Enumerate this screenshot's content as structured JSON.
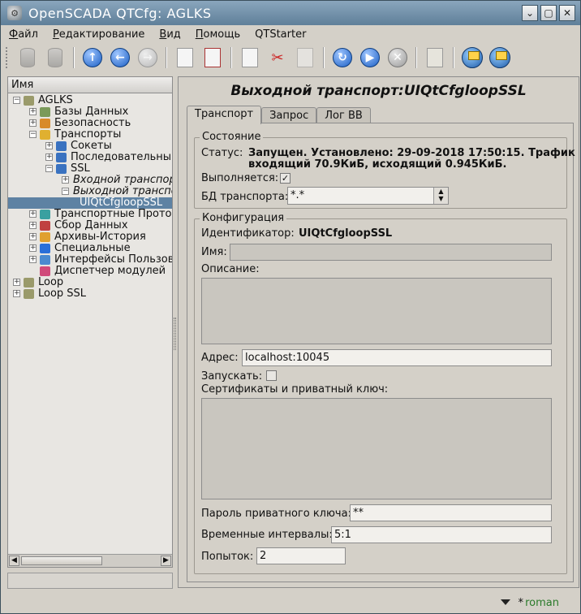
{
  "window": {
    "title": "OpenSCADA QTCfg: AGLKS",
    "buttons": [
      "⌄",
      "▢",
      "✕"
    ]
  },
  "menu": {
    "items": [
      {
        "underline": "Ф",
        "rest": "айл"
      },
      {
        "underline": "Р",
        "rest": "едактирование"
      },
      {
        "underline": "В",
        "rest": "ид"
      },
      {
        "underline": "П",
        "rest": "омощь"
      },
      {
        "underline": "",
        "rest": "QTStarter"
      }
    ]
  },
  "toolbar": {
    "icons": [
      "db-load-icon",
      "db-save-icon",
      "up-icon",
      "back-icon",
      "forward-icon",
      "add-item-icon",
      "delete-item-icon",
      "copy-icon",
      "cut-icon",
      "paste-icon",
      "refresh-icon",
      "start-icon",
      "stop-icon",
      "manual-icon",
      "remote-station-icon",
      "remote-station2-icon"
    ]
  },
  "tree": {
    "header": "Имя",
    "items": [
      {
        "label": "AGLKS",
        "indent": 0,
        "exp": "−",
        "icon": "station-icon",
        "color": "#9a9a6a"
      },
      {
        "label": "Базы Данных",
        "indent": 1,
        "exp": "+",
        "icon": "database-icon",
        "color": "#7a9a5a"
      },
      {
        "label": "Безопасность",
        "indent": 1,
        "exp": "+",
        "icon": "security-icon",
        "color": "#d88a2a"
      },
      {
        "label": "Транспорты",
        "indent": 1,
        "exp": "−",
        "icon": "transport-icon",
        "color": "#e0b030"
      },
      {
        "label": "Сокеты",
        "indent": 2,
        "exp": "+",
        "icon": "sockets-icon",
        "color": "#3a72c0"
      },
      {
        "label": "Последовательны",
        "indent": 2,
        "exp": "+",
        "icon": "serial-icon",
        "color": "#3a72c0"
      },
      {
        "label": "SSL",
        "indent": 2,
        "exp": "−",
        "icon": "ssl-icon",
        "color": "#3a72c0"
      },
      {
        "label": "Входной транспор",
        "indent": 3,
        "exp": "+",
        "icon": "",
        "color": "",
        "italic": true
      },
      {
        "label": "Выходной транспо",
        "indent": 3,
        "exp": "−",
        "icon": "",
        "color": "",
        "italic": true
      },
      {
        "label": "UIQtCfgloopSSL",
        "indent": 4,
        "exp": "",
        "icon": "",
        "color": "",
        "selected": true
      },
      {
        "label": "Транспортные Прото",
        "indent": 1,
        "exp": "+",
        "icon": "protocols-icon",
        "color": "#3aa0a0"
      },
      {
        "label": "Сбор Данных",
        "indent": 1,
        "exp": "+",
        "icon": "daq-icon",
        "color": "#c04040"
      },
      {
        "label": "Архивы-История",
        "indent": 1,
        "exp": "+",
        "icon": "archives-icon",
        "color": "#e0a030"
      },
      {
        "label": "Специальные",
        "indent": 1,
        "exp": "+",
        "icon": "special-icon",
        "color": "#2a6fd8"
      },
      {
        "label": "Интерфейсы Пользов",
        "indent": 1,
        "exp": "+",
        "icon": "ui-icon",
        "color": "#4a8ad0"
      },
      {
        "label": "Диспетчер модулей",
        "indent": 1,
        "exp": "",
        "icon": "modules-icon",
        "color": "#d04a7a"
      },
      {
        "label": "Loop",
        "indent": 0,
        "exp": "+",
        "icon": "station-icon",
        "color": "#9a9a6a"
      },
      {
        "label": "Loop SSL",
        "indent": 0,
        "exp": "+",
        "icon": "station-icon",
        "color": "#9a9a6a"
      }
    ]
  },
  "page": {
    "title": "Выходной транспорт:UIQtCfgloopSSL",
    "tabs": [
      "Транспорт",
      "Запрос",
      "Лог ВВ"
    ],
    "state_group": {
      "title": "Состояние",
      "status_label": "Статус:",
      "status_value_line1": "Запущен. Установлено: 29-09-2018 17:50:15. Трафик",
      "status_value_line2": "входящий 70.9КиБ, исходящий 0.945КиБ.",
      "running_label": "Выполняется:",
      "running_checked": true,
      "running_mark": "✓",
      "db_label": "БД транспорта:",
      "db_value": "*.*"
    },
    "config_group": {
      "title": "Конфигурация",
      "id_label": "Идентификатор:",
      "id_value": "UIQtCfgloopSSL",
      "name_label": "Имя:",
      "name_value": "",
      "descr_label": "Описание:",
      "addr_label": "Адрес:",
      "addr_value": "localhost:10045",
      "start_label": "Запускать:",
      "start_checked": false,
      "certs_label": "Сертификаты и приватный ключ:",
      "pkey_pass_label": "Пароль приватного ключа:",
      "pkey_pass_value": "**",
      "timings_label": "Временные интервалы:",
      "timings_value": "5:1",
      "attempts_label": "Попыток:",
      "attempts_value": "2"
    }
  },
  "statusbar": {
    "star": "*",
    "user": "roman"
  }
}
